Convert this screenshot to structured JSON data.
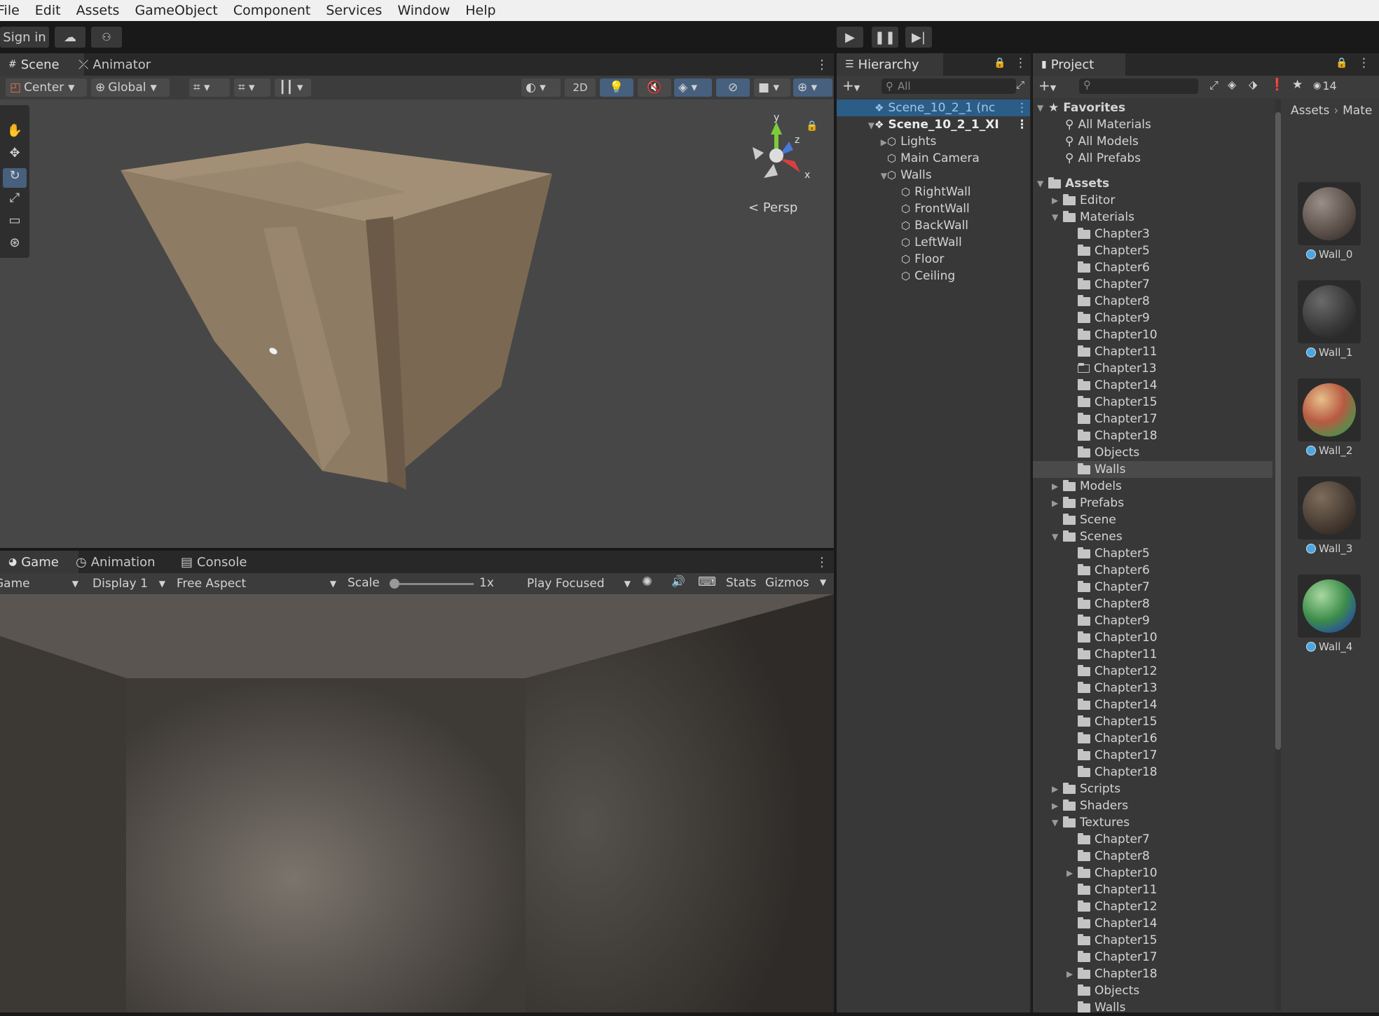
{
  "menu": [
    "File",
    "Edit",
    "Assets",
    "GameObject",
    "Component",
    "Services",
    "Window",
    "Help"
  ],
  "toolbar": {
    "sign_in": "Sign in"
  },
  "scene_panel": {
    "tabs": [
      "Scene",
      "Animator"
    ],
    "pivot": "Center",
    "space": "Global",
    "mode_2d": "2D",
    "persp": "Persp",
    "axes": {
      "y": "y",
      "z": "z",
      "x": "x"
    }
  },
  "game_panel": {
    "tabs": [
      "Game",
      "Animation",
      "Console"
    ],
    "game_label": "Game",
    "display": "Display 1",
    "aspect": "Free Aspect",
    "scale_label": "Scale",
    "scale_value": "1x",
    "play_mode": "Play Focused",
    "stats": "Stats",
    "gizmos": "Gizmos"
  },
  "hierarchy": {
    "title": "Hierarchy",
    "search_placeholder": "All",
    "items": [
      {
        "label": "Scene_10_2_1 (nc",
        "depth": 0
      },
      {
        "label": "Scene_10_2_1_XI",
        "depth": 0
      },
      {
        "label": "Lights",
        "depth": 1
      },
      {
        "label": "Main Camera",
        "depth": 1
      },
      {
        "label": "Walls",
        "depth": 1
      },
      {
        "label": "RightWall",
        "depth": 2
      },
      {
        "label": "FrontWall",
        "depth": 2
      },
      {
        "label": "BackWall",
        "depth": 2
      },
      {
        "label": "LeftWall",
        "depth": 2
      },
      {
        "label": "Floor",
        "depth": 2
      },
      {
        "label": "Ceiling",
        "depth": 2
      }
    ]
  },
  "project": {
    "title": "Project",
    "hidden_count": "14",
    "breadcrumb": [
      "Assets",
      "Mate"
    ],
    "favorites_label": "Favorites",
    "favorites": [
      "All Materials",
      "All Models",
      "All Prefabs"
    ],
    "tree": [
      {
        "label": "Assets",
        "depth": 0,
        "arrow": "open",
        "bold": true
      },
      {
        "label": "Editor",
        "depth": 1,
        "arrow": "closed"
      },
      {
        "label": "Materials",
        "depth": 1,
        "arrow": "open"
      },
      {
        "label": "Chapter3",
        "depth": 2
      },
      {
        "label": "Chapter5",
        "depth": 2
      },
      {
        "label": "Chapter6",
        "depth": 2
      },
      {
        "label": "Chapter7",
        "depth": 2
      },
      {
        "label": "Chapter8",
        "depth": 2
      },
      {
        "label": "Chapter9",
        "depth": 2
      },
      {
        "label": "Chapter10",
        "depth": 2
      },
      {
        "label": "Chapter11",
        "depth": 2
      },
      {
        "label": "Chapter13",
        "depth": 2,
        "empty": true
      },
      {
        "label": "Chapter14",
        "depth": 2
      },
      {
        "label": "Chapter15",
        "depth": 2
      },
      {
        "label": "Chapter17",
        "depth": 2
      },
      {
        "label": "Chapter18",
        "depth": 2
      },
      {
        "label": "Objects",
        "depth": 2
      },
      {
        "label": "Walls",
        "depth": 2,
        "selected": true
      },
      {
        "label": "Models",
        "depth": 1,
        "arrow": "closed"
      },
      {
        "label": "Prefabs",
        "depth": 1,
        "arrow": "closed"
      },
      {
        "label": "Scene",
        "depth": 1
      },
      {
        "label": "Scenes",
        "depth": 1,
        "arrow": "open"
      },
      {
        "label": "Chapter5",
        "depth": 2
      },
      {
        "label": "Chapter6",
        "depth": 2
      },
      {
        "label": "Chapter7",
        "depth": 2
      },
      {
        "label": "Chapter8",
        "depth": 2
      },
      {
        "label": "Chapter9",
        "depth": 2
      },
      {
        "label": "Chapter10",
        "depth": 2
      },
      {
        "label": "Chapter11",
        "depth": 2
      },
      {
        "label": "Chapter12",
        "depth": 2
      },
      {
        "label": "Chapter13",
        "depth": 2
      },
      {
        "label": "Chapter14",
        "depth": 2
      },
      {
        "label": "Chapter15",
        "depth": 2
      },
      {
        "label": "Chapter16",
        "depth": 2
      },
      {
        "label": "Chapter17",
        "depth": 2
      },
      {
        "label": "Chapter18",
        "depth": 2
      },
      {
        "label": "Scripts",
        "depth": 1,
        "arrow": "closed"
      },
      {
        "label": "Shaders",
        "depth": 1,
        "arrow": "closed"
      },
      {
        "label": "Textures",
        "depth": 1,
        "arrow": "open"
      },
      {
        "label": "Chapter7",
        "depth": 2
      },
      {
        "label": "Chapter8",
        "depth": 2
      },
      {
        "label": "Chapter10",
        "depth": 2,
        "arrow": "closed"
      },
      {
        "label": "Chapter11",
        "depth": 2
      },
      {
        "label": "Chapter12",
        "depth": 2
      },
      {
        "label": "Chapter14",
        "depth": 2
      },
      {
        "label": "Chapter15",
        "depth": 2
      },
      {
        "label": "Chapter17",
        "depth": 2
      },
      {
        "label": "Chapter18",
        "depth": 2,
        "arrow": "closed"
      },
      {
        "label": "Objects",
        "depth": 2
      },
      {
        "label": "Walls",
        "depth": 2
      }
    ],
    "materials": [
      {
        "label": "Wall_0",
        "color": "#6e625c"
      },
      {
        "label": "Wall_1",
        "color": "#3e3e3e"
      },
      {
        "label": "Wall_2",
        "color": "#b86a4a"
      },
      {
        "label": "Wall_3",
        "color": "#4e4338"
      },
      {
        "label": "Wall_4",
        "color": "#3f8c4c"
      }
    ]
  },
  "colors": {
    "accent": "#2c5d87",
    "play_bg": "#3c3c3c",
    "bg": "#383838"
  }
}
